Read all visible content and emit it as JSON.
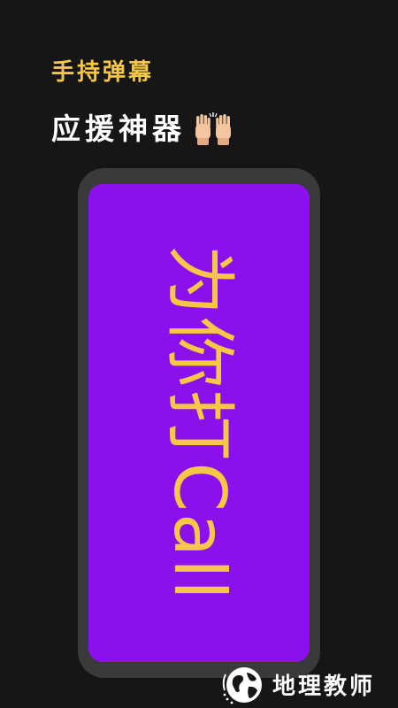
{
  "header": {
    "subtitle": "手持弹幕",
    "headline": "应援神器",
    "headline_icon": "raised-hands-icon"
  },
  "phone": {
    "danmaku_text": "为你打Call",
    "screen_color": "#8a10ee",
    "text_color": "#f6c744"
  },
  "watermark": {
    "icon": "globe-icon",
    "text": "地理教师"
  }
}
